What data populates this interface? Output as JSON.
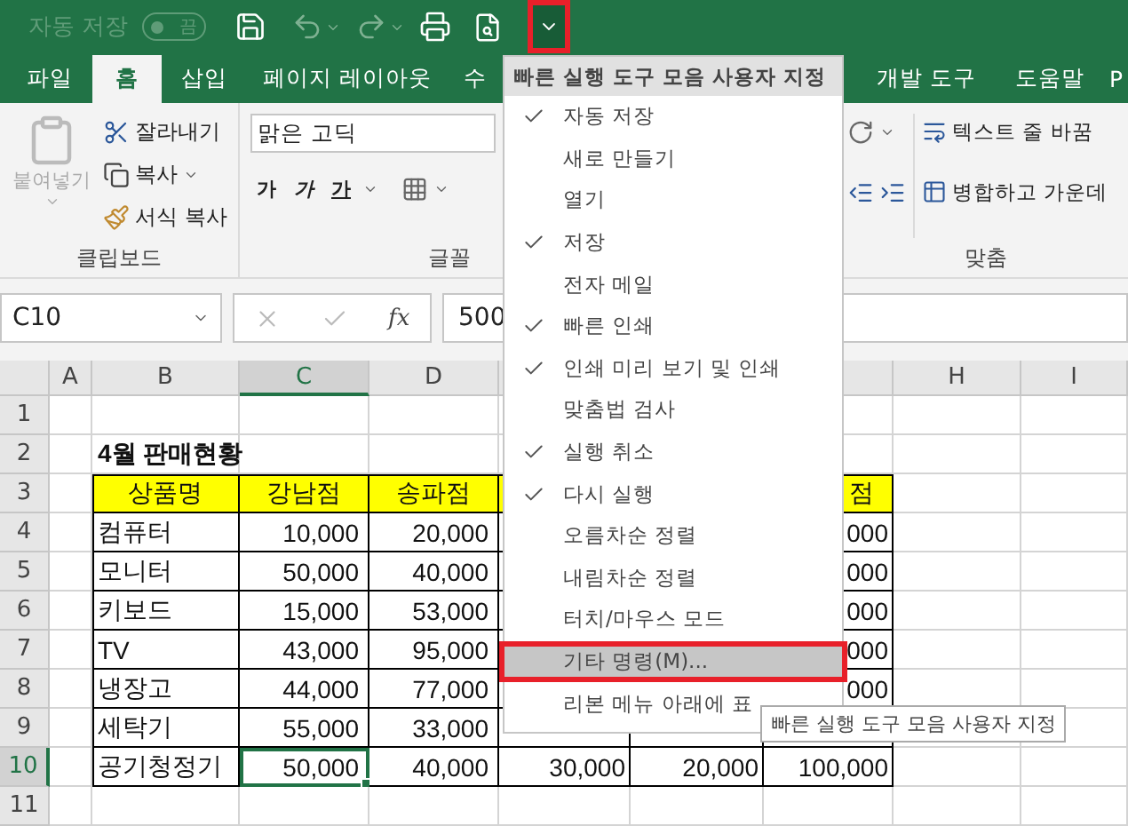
{
  "title_bar": {
    "autosave": {
      "label": "자동 저장",
      "state_label": "끔",
      "on": false
    },
    "customize_button": {
      "highlighted": true
    }
  },
  "tabs": [
    {
      "label": "파일",
      "selected": false
    },
    {
      "label": "홈",
      "selected": true
    },
    {
      "label": "삽입",
      "selected": false
    },
    {
      "label": "페이지 레이아웃",
      "selected": false
    },
    {
      "label": "수",
      "selected": false
    },
    {
      "label": "개발 도구",
      "selected": false
    },
    {
      "label": "도움말",
      "selected": false
    },
    {
      "label": "P",
      "selected": false
    }
  ],
  "ribbon": {
    "clipboard": {
      "paste": "붙여넣기",
      "paste_disabled": true,
      "cut": "잘라내기",
      "copy": "복사",
      "format_painter": "서식 복사",
      "label": "클립보드"
    },
    "font": {
      "font_name": "맑은 고딕",
      "style_buttons": [
        "가",
        "가",
        "가"
      ],
      "label": "글꼴"
    },
    "alignment": {
      "wrap_text": "텍스트 줄 바꿈",
      "merge_center": "병합하고 가운데",
      "label": "맞춤"
    }
  },
  "formula_bar": {
    "name_box": "C10",
    "fx": "fx",
    "value": "500"
  },
  "sheet": {
    "columns": [
      {
        "label": "A",
        "selected": false
      },
      {
        "label": "B",
        "selected": false
      },
      {
        "label": "C",
        "selected": true
      },
      {
        "label": "D",
        "selected": false
      },
      {
        "label": "H",
        "selected": false
      },
      {
        "label": "I",
        "selected": false
      }
    ],
    "rows": [
      {
        "label": "1",
        "kind": "blank",
        "selected": false,
        "cells": [
          null,
          null,
          null,
          null,
          null,
          null,
          null,
          null,
          null
        ]
      },
      {
        "label": "2",
        "kind": "title",
        "selected": false,
        "cells": [
          null,
          "4월 판매현황",
          null,
          null,
          null,
          null,
          null,
          null,
          null
        ]
      },
      {
        "label": "3",
        "kind": "header",
        "selected": false,
        "cells": [
          null,
          "상품명",
          "강남점",
          "송파점",
          null,
          null,
          "점",
          null,
          null
        ]
      },
      {
        "label": "4",
        "kind": "data",
        "selected": false,
        "cells": [
          null,
          "컴퓨터",
          "10,000",
          "20,000",
          null,
          null,
          "000",
          null,
          null
        ]
      },
      {
        "label": "5",
        "kind": "data",
        "selected": false,
        "cells": [
          null,
          "모니터",
          "50,000",
          "40,000",
          null,
          null,
          "000",
          null,
          null
        ]
      },
      {
        "label": "6",
        "kind": "data",
        "selected": false,
        "cells": [
          null,
          "키보드",
          "15,000",
          "53,000",
          null,
          null,
          "000",
          null,
          null
        ]
      },
      {
        "label": "7",
        "kind": "data",
        "selected": false,
        "cells": [
          null,
          "TV",
          "43,000",
          "95,000",
          null,
          null,
          "000",
          null,
          null
        ]
      },
      {
        "label": "8",
        "kind": "data",
        "selected": false,
        "cells": [
          null,
          "냉장고",
          "44,000",
          "77,000",
          null,
          null,
          "000",
          null,
          null
        ]
      },
      {
        "label": "9",
        "kind": "data",
        "selected": false,
        "cells": [
          null,
          "세탁기",
          "55,000",
          "33,000",
          null,
          null,
          null,
          null,
          null
        ]
      },
      {
        "label": "10",
        "kind": "data",
        "selected": true,
        "cells": [
          null,
          "공기청정기",
          "50,000",
          "40,000",
          "30,000",
          "20,000",
          "100,000",
          null,
          null
        ]
      },
      {
        "label": "11",
        "kind": "blank",
        "selected": false,
        "cells": [
          null,
          null,
          null,
          null,
          null,
          null,
          null,
          null,
          null
        ]
      }
    ]
  },
  "quick_access_menu": {
    "title": "빠른 실행 도구 모음 사용자 지정",
    "items": [
      {
        "label": "자동 저장",
        "checked": true,
        "selected": false
      },
      {
        "label": "새로 만들기",
        "checked": false,
        "selected": false
      },
      {
        "label": "열기",
        "checked": false,
        "selected": false
      },
      {
        "label": "저장",
        "checked": true,
        "selected": false
      },
      {
        "label": "전자 메일",
        "checked": false,
        "selected": false
      },
      {
        "label": "빠른 인쇄",
        "checked": true,
        "selected": false
      },
      {
        "label": "인쇄 미리 보기 및 인쇄",
        "checked": true,
        "selected": false
      },
      {
        "label": "맞춤법 검사",
        "checked": false,
        "selected": false
      },
      {
        "label": "실행 취소",
        "checked": true,
        "selected": false
      },
      {
        "label": "다시 실행",
        "checked": true,
        "selected": false
      },
      {
        "label": "오름차순 정렬",
        "checked": false,
        "selected": false
      },
      {
        "label": "내림차순 정렬",
        "checked": false,
        "selected": false
      },
      {
        "label": "터치/마우스 모드",
        "checked": false,
        "selected": false
      },
      {
        "label": "기타 명령(M)...",
        "checked": false,
        "selected": true
      },
      {
        "label": "리본 메뉴 아래에 표",
        "checked": false,
        "selected": false
      }
    ]
  },
  "tooltip": "빠른 실행 도구 모음 사용자 지정"
}
